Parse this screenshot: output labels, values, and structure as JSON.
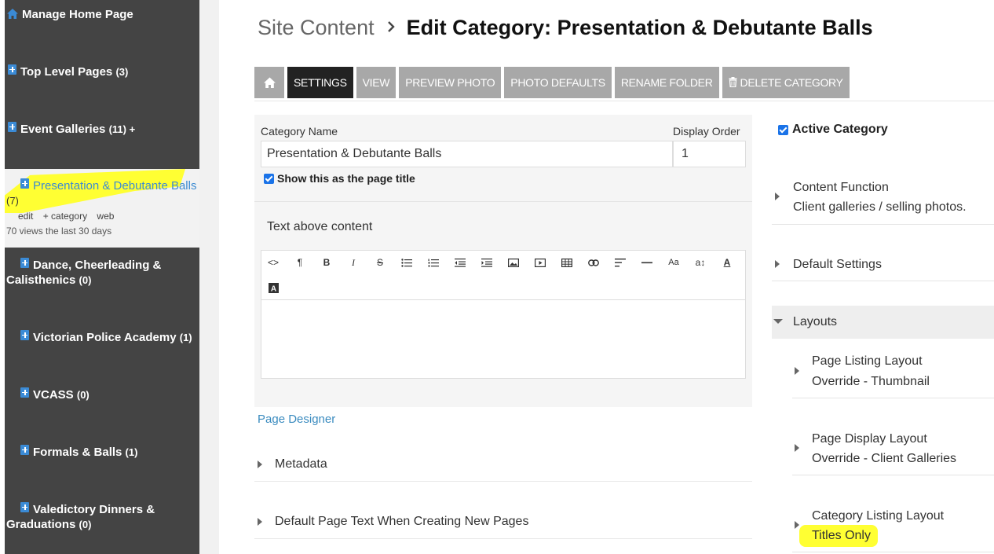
{
  "sidebar": {
    "items": [
      {
        "label": "Manage Home Page",
        "count": ""
      },
      {
        "label": "Top Level Pages",
        "count": "(3)"
      },
      {
        "label": "Event Galleries",
        "count": "(11) +"
      },
      {
        "label": "Dance, Cheerleading & Calisthenics",
        "count": "(0)"
      },
      {
        "label": "Victorian Police Academy",
        "count": "(1)"
      },
      {
        "label": "VCASS",
        "count": "(0)"
      },
      {
        "label": "Formals & Balls",
        "count": "(1)"
      },
      {
        "label": "Valedictory Dinners & Graduations",
        "count": "(0)"
      }
    ],
    "active": {
      "label": "Presentation & Debutante Balls",
      "count": "(7)",
      "actions": [
        "edit",
        "+ category",
        "web"
      ],
      "views": "70 views the last 30 days"
    }
  },
  "breadcrumb": {
    "root": "Site Content",
    "current": "Edit Category: Presentation & Debutante Balls"
  },
  "toolbar": {
    "settings": "SETTINGS",
    "view": "VIEW",
    "preview_photo": "PREVIEW PHOTO",
    "photo_defaults": "PHOTO DEFAULTS",
    "rename_folder": "RENAME FOLDER",
    "delete_category": "DELETE CATEGORY"
  },
  "form": {
    "category_name_label": "Category Name",
    "category_name_value": "Presentation & Debutante Balls",
    "display_order_label": "Display Order",
    "display_order_value": "1",
    "show_title_label": "Show this as the page title",
    "text_above_label": "Text above content",
    "page_designer": "Page Designer",
    "metadata": "Metadata",
    "default_page_text": "Default Page Text When Creating New Pages"
  },
  "right": {
    "active_category": "Active Category",
    "content_function_label": "Content Function",
    "content_function_value": "Client galleries / selling photos.",
    "default_settings": "Default Settings",
    "layouts": "Layouts",
    "page_listing_label": "Page Listing Layout",
    "page_listing_value": "Override - Thumbnail",
    "page_display_label": "Page Display Layout",
    "page_display_value": "Override - Client Galleries",
    "category_listing_label": "Category Listing Layout",
    "category_listing_value": "Titles Only"
  },
  "colors": {
    "sidebar_bg": "#444444",
    "highlight": "#ffff33",
    "link": "#3a8bbf",
    "button_gray": "#a8a8a8",
    "button_active": "#222222"
  }
}
